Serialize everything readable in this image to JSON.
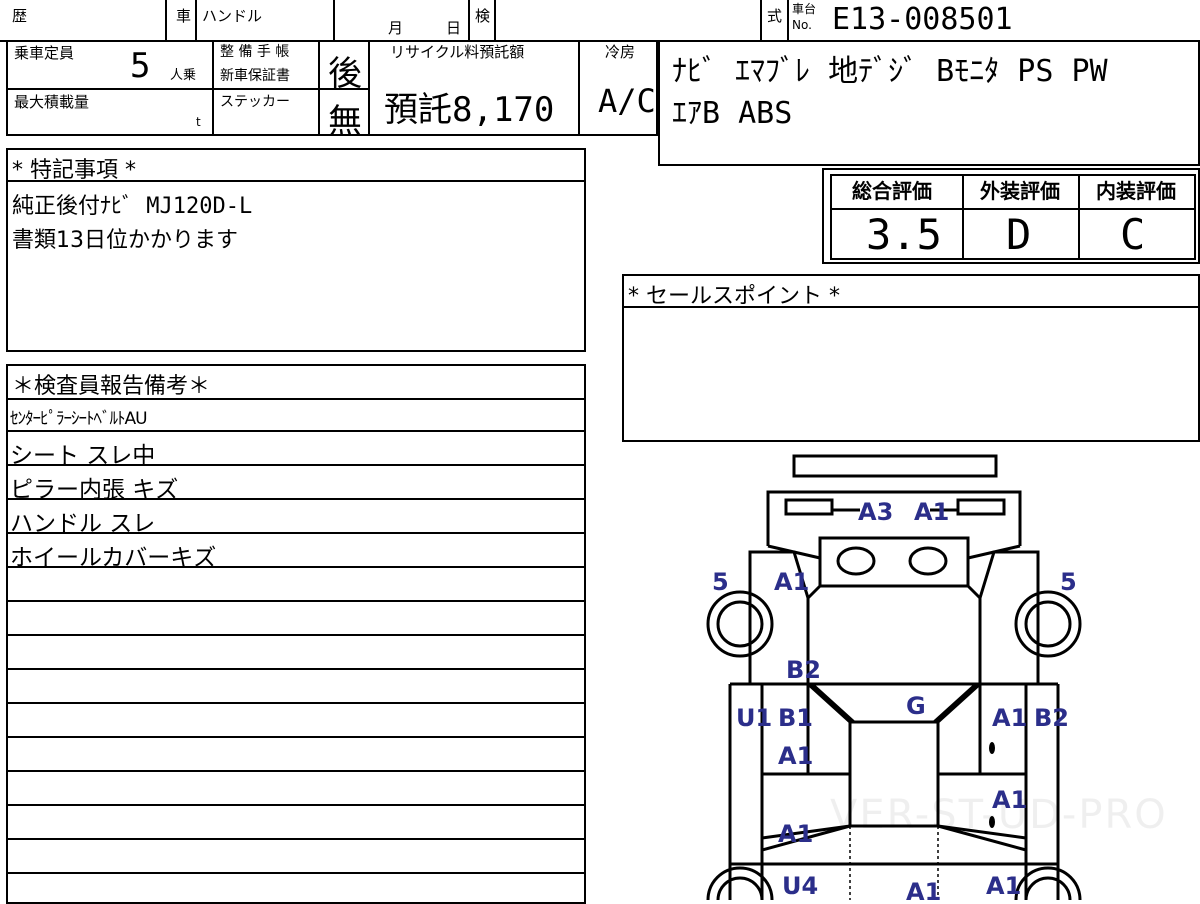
{
  "header": {
    "reki_label": "歴",
    "sha_label": "車",
    "handle_label": "ハンドル",
    "month_label": "月",
    "day_label": "日",
    "ken_label": "検",
    "shiki_label": "式",
    "shadai_label": "車台",
    "no_label": "No.",
    "chassis_number": "E13-008501"
  },
  "specs": {
    "capacity_label": "乗車定員",
    "capacity_value": "5",
    "capacity_unit": "人乗",
    "maxload_label": "最大積載量",
    "maxload_unit": "t",
    "maint_label_1": "整 備 手 帳",
    "maint_label_2": "新車保証書",
    "maint_value": "後",
    "sticker_label": "ステッカー",
    "sticker_value": "無",
    "recycle_label": "リサイクル料預託額",
    "recycle_value": "預託8,170",
    "aircon_label": "冷房",
    "aircon_value": "A/C"
  },
  "equipment": {
    "line1": "ﾅﾋﾞ ｴﾏﾌﾞﾚ 地ﾃﾞｼﾞ Bﾓﾆﾀ PS PW",
    "line2": "ｴｱB ABS"
  },
  "ratings": {
    "overall_label": "総合評価",
    "overall_value": "3.5",
    "exterior_label": "外装評価",
    "exterior_value": "D",
    "interior_label": "内装評価",
    "interior_value": "C"
  },
  "special_notes": {
    "title": "* 特記事項 *",
    "lines": [
      "純正後付ﾅﾋﾞ MJ120D-L",
      "書類13日位かかります"
    ]
  },
  "sales_points": {
    "title": "* セールスポイント *"
  },
  "inspector_notes": {
    "title": "＊検査員報告備考＊",
    "lines": [
      "ｾﾝﾀｰﾋﾟﾗｰｼｰﾄﾍﾞﾙﾄAU",
      "シート スレ中",
      "ピラー内張 キズ",
      "ハンドル スレ",
      "ホイールカバーキズ"
    ]
  },
  "damage_map": {
    "marks": {
      "front_a3": "A3",
      "front_a1": "A1",
      "left_tire": "5",
      "right_tire": "5",
      "left_fender": "A1",
      "left_b2": "B2",
      "left_u1": "U1",
      "left_b1": "B1",
      "windshield_g": "G",
      "right_a1": "A1",
      "right_b2": "B2",
      "left_door_a1": "A1",
      "right_door_a1": "A1",
      "left_rear_door_a1": "A1",
      "left_u4": "U4",
      "rear_a1": "A1",
      "right_rear_a1": "A1"
    },
    "watermark": "VER-ST-UD-PRO",
    "mark_color": "#2b2e8a"
  }
}
